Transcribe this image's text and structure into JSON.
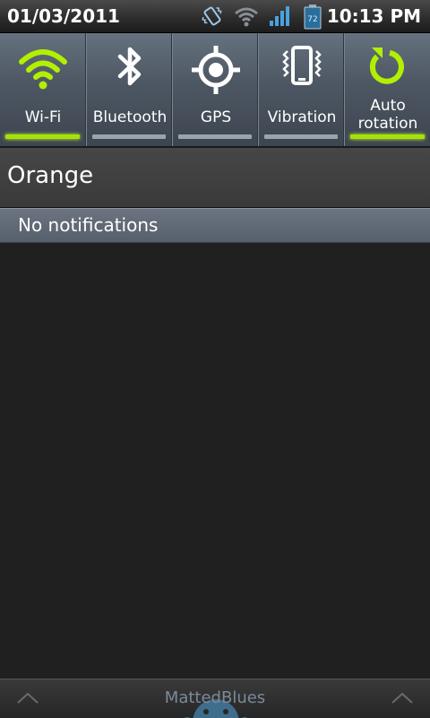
{
  "status_bar": {
    "date": "01/03/2011",
    "time": "10:13 PM",
    "battery_level": "72",
    "icons": [
      "vibrate-icon",
      "wifi-icon",
      "signal-icon",
      "battery-icon"
    ]
  },
  "quick_settings": [
    {
      "id": "wifi",
      "label": "Wi-Fi",
      "enabled": true,
      "icon": "wifi-icon"
    },
    {
      "id": "bluetooth",
      "label": "Bluetooth",
      "enabled": false,
      "icon": "bluetooth-icon"
    },
    {
      "id": "gps",
      "label": "GPS",
      "enabled": false,
      "icon": "gps-icon"
    },
    {
      "id": "vibration",
      "label": "Vibration",
      "enabled": false,
      "icon": "vibration-icon"
    },
    {
      "id": "autorotation",
      "label_line1": "Auto",
      "label_line2": "rotation",
      "enabled": true,
      "icon": "auto-rotation-icon"
    }
  ],
  "carrier": "Orange",
  "notifications_header": "No notifications",
  "handle": {
    "text": "MattedBlues"
  },
  "colors": {
    "accent_green": "#a4e400",
    "panel_grey": "#56606c",
    "background": "#202020"
  }
}
